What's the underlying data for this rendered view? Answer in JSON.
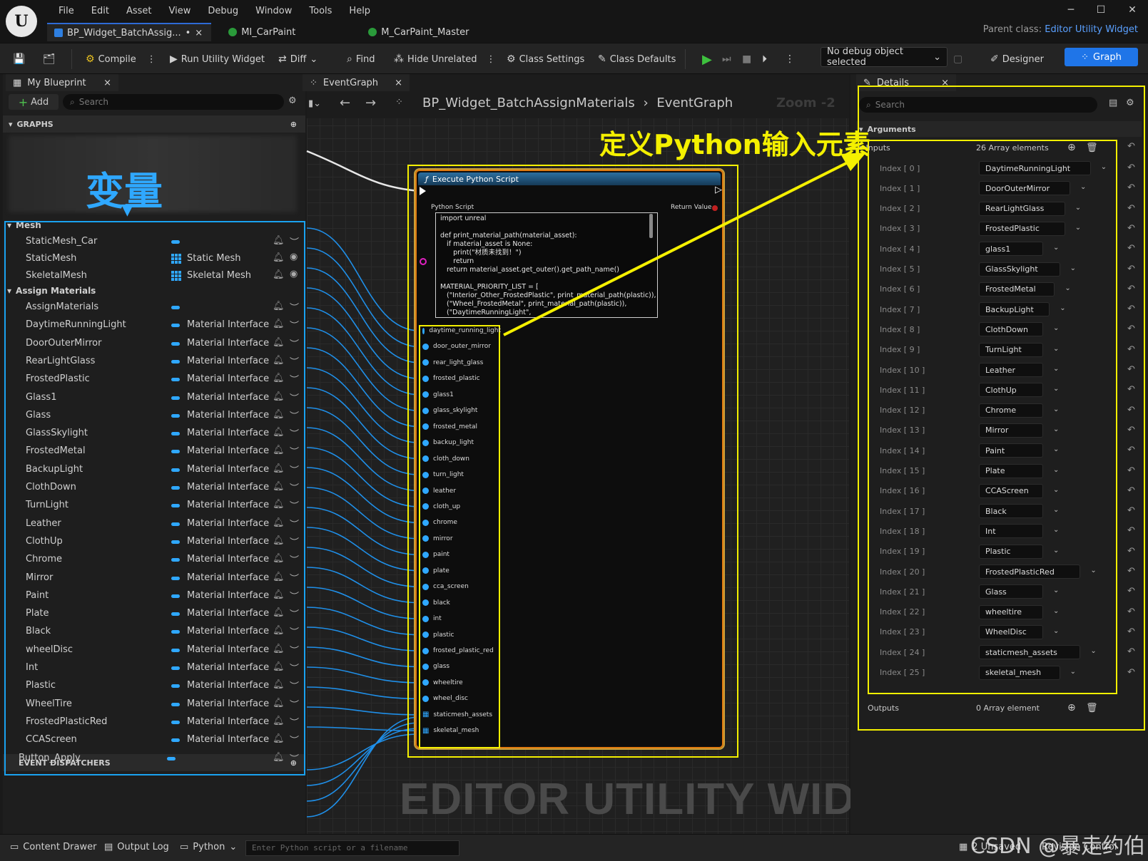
{
  "window": {
    "menu": [
      "File",
      "Edit",
      "Asset",
      "View",
      "Debug",
      "Window",
      "Tools",
      "Help"
    ],
    "tabs": [
      {
        "label": "BP_Widget_BatchAssig...",
        "suffix": "•",
        "close": "×"
      },
      {
        "label": "MI_CarPaint"
      },
      {
        "label": "M_CarPaint_Master"
      }
    ],
    "parent_class_label": "Parent class:",
    "parent_class_value": "Editor Utility Widget"
  },
  "toolbar": {
    "compile": "Compile",
    "run": "Run Utility Widget",
    "diff": "Diff",
    "find": "Find",
    "hide_unrelated": "Hide Unrelated",
    "class_settings": "Class Settings",
    "class_defaults": "Class Defaults",
    "debug_select": "No debug object selected",
    "designer": "Designer",
    "graph": "Graph"
  },
  "my_blueprint": {
    "tab_label": "My Blueprint",
    "add_label": "Add",
    "search_placeholder": "Search",
    "graphs_label": "GRAPHS",
    "event_dispatchers_label": "EVENT DISPATCHERS",
    "categories": [
      {
        "name": "Mesh",
        "vars": [
          {
            "name": "StaticMesh_Car",
            "type": ""
          },
          {
            "name": "StaticMesh",
            "type": "Static Mesh"
          },
          {
            "name": "SkeletalMesh",
            "type": "Skeletal Mesh"
          }
        ]
      },
      {
        "name": "Assign Materials",
        "vars": [
          {
            "name": "AssignMaterials",
            "type": ""
          },
          {
            "name": "DaytimeRunningLight",
            "type": "Material Interface"
          },
          {
            "name": "DoorOuterMirror",
            "type": "Material Interface"
          },
          {
            "name": "RearLightGlass",
            "type": "Material Interface"
          },
          {
            "name": "FrostedPlastic",
            "type": "Material Interface"
          },
          {
            "name": "Glass1",
            "type": "Material Interface"
          },
          {
            "name": "Glass",
            "type": "Material Interface"
          },
          {
            "name": "GlassSkylight",
            "type": "Material Interface"
          },
          {
            "name": "FrostedMetal",
            "type": "Material Interface"
          },
          {
            "name": "BackupLight",
            "type": "Material Interface"
          },
          {
            "name": "ClothDown",
            "type": "Material Interface"
          },
          {
            "name": "TurnLight",
            "type": "Material Interface"
          },
          {
            "name": "Leather",
            "type": "Material Interface"
          },
          {
            "name": "ClothUp",
            "type": "Material Interface"
          },
          {
            "name": "Chrome",
            "type": "Material Interface"
          },
          {
            "name": "Mirror",
            "type": "Material Interface"
          },
          {
            "name": "Paint",
            "type": "Material Interface"
          },
          {
            "name": "Plate",
            "type": "Material Interface"
          },
          {
            "name": "Black",
            "type": "Material Interface"
          },
          {
            "name": "wheelDisc",
            "type": "Material Interface"
          },
          {
            "name": "Int",
            "type": "Material Interface"
          },
          {
            "name": "Plastic",
            "type": "Material Interface"
          },
          {
            "name": "WheelTire",
            "type": "Material Interface"
          },
          {
            "name": "FrostedPlasticRed",
            "type": "Material Interface"
          },
          {
            "name": "CCAScreen",
            "type": "Material Interface"
          }
        ]
      }
    ],
    "button_apply": "Button_Apply"
  },
  "graph": {
    "tab_label": "EventGraph",
    "breadcrumb_root": "BP_Widget_BatchAssignMaterials",
    "breadcrumb_leaf": "EventGraph",
    "zoom": "Zoom -2",
    "watermark": "EDITOR UTILITY WIDGET",
    "node": {
      "title": "Execute Python Script",
      "python_script_label": "Python Script",
      "return_value_label": "Return Value",
      "code": "import unreal\n\ndef print_material_path(material_asset):\n   if material_asset is None:\n      print(\"材质未找到！\")\n      return\n   return material_asset.get_outer().get_path_name()\n\nMATERIAL_PRIORITY_LIST = [\n   (\"Interior_Other_FrostedPlastic\", print_material_path(plastic)),\n   (\"Wheel_FrostedMetal\", print_material_path(plastic)),\n   (\"DaytimeRunningLight\",",
      "pins": [
        "daytime_running_light",
        "door_outer_mirror",
        "rear_light_glass",
        "frosted_plastic",
        "glass1",
        "glass_skylight",
        "frosted_metal",
        "backup_light",
        "cloth_down",
        "turn_light",
        "leather",
        "cloth_up",
        "chrome",
        "mirror",
        "paint",
        "plate",
        "cca_screen",
        "black",
        "int",
        "plastic",
        "frosted_plastic_red",
        "glass",
        "wheeltire",
        "wheel_disc",
        "staticmesh_assets",
        "skeletal_mesh"
      ]
    }
  },
  "details": {
    "tab_label": "Details",
    "search_placeholder": "Search",
    "arguments_label": "Arguments",
    "inputs_label": "Inputs",
    "inputs_count": "26 Array elements",
    "outputs_label": "Outputs",
    "outputs_count": "0 Array element",
    "items": [
      {
        "index": "Index [ 0 ]",
        "value": "DaytimeRunningLight"
      },
      {
        "index": "Index [ 1 ]",
        "value": "DoorOuterMirror"
      },
      {
        "index": "Index [ 2 ]",
        "value": "RearLightGlass"
      },
      {
        "index": "Index [ 3 ]",
        "value": "FrostedPlastic"
      },
      {
        "index": "Index [ 4 ]",
        "value": "glass1"
      },
      {
        "index": "Index [ 5 ]",
        "value": "GlassSkylight"
      },
      {
        "index": "Index [ 6 ]",
        "value": "FrostedMetal"
      },
      {
        "index": "Index [ 7 ]",
        "value": "BackupLight"
      },
      {
        "index": "Index [ 8 ]",
        "value": "ClothDown"
      },
      {
        "index": "Index [ 9 ]",
        "value": "TurnLight"
      },
      {
        "index": "Index [ 10 ]",
        "value": "Leather"
      },
      {
        "index": "Index [ 11 ]",
        "value": "ClothUp"
      },
      {
        "index": "Index [ 12 ]",
        "value": "Chrome"
      },
      {
        "index": "Index [ 13 ]",
        "value": "Mirror"
      },
      {
        "index": "Index [ 14 ]",
        "value": "Paint"
      },
      {
        "index": "Index [ 15 ]",
        "value": "Plate"
      },
      {
        "index": "Index [ 16 ]",
        "value": "CCAScreen"
      },
      {
        "index": "Index [ 17 ]",
        "value": "Black"
      },
      {
        "index": "Index [ 18 ]",
        "value": "Int"
      },
      {
        "index": "Index [ 19 ]",
        "value": "Plastic"
      },
      {
        "index": "Index [ 20 ]",
        "value": "FrostedPlasticRed"
      },
      {
        "index": "Index [ 21 ]",
        "value": "Glass"
      },
      {
        "index": "Index [ 22 ]",
        "value": "wheeltire"
      },
      {
        "index": "Index [ 23 ]",
        "value": "WheelDisc"
      },
      {
        "index": "Index [ 24 ]",
        "value": "staticmesh_assets"
      },
      {
        "index": "Index [ 25 ]",
        "value": "skeletal_mesh"
      }
    ]
  },
  "annotations": {
    "variables_cn": "变量",
    "python_inputs_cn": "定义Python输入元素"
  },
  "bottom": {
    "content_drawer": "Content Drawer",
    "output_log": "Output Log",
    "python": "Python",
    "cmd_placeholder": "Enter Python script or a filename",
    "unsaved": "2 Unsaved",
    "revision": "Revision Control",
    "csdn_watermark": "CSDN @暴走约伯"
  },
  "colors": {
    "accent_blue": "#1f75e8",
    "pin_blue": "#2fa8ff",
    "annotation_yellow": "#f4f000",
    "annotation_blue": "#1aa2f0",
    "node_border": "#e07a10"
  }
}
